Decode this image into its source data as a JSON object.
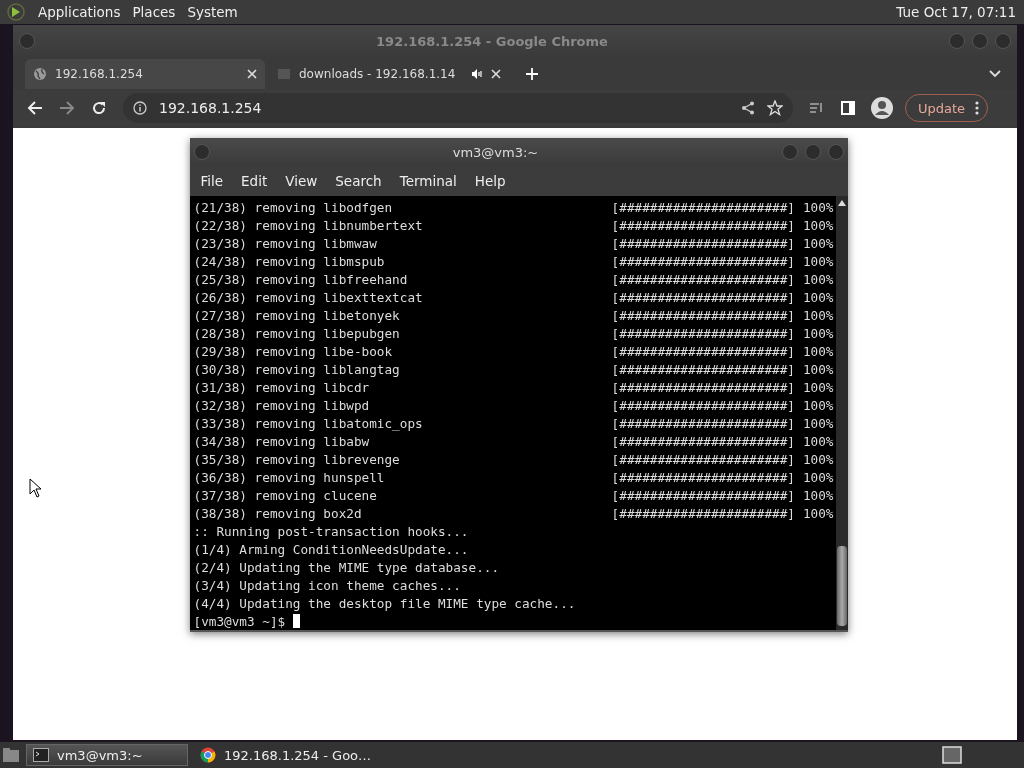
{
  "top_panel": {
    "menus": [
      "Applications",
      "Places",
      "System"
    ],
    "clock": "Tue Oct 17, 07:11"
  },
  "browser": {
    "title": "192.168.1.254 - Google Chrome",
    "tabs": [
      {
        "label": "192.168.1.254",
        "selected": true,
        "kind": "globe",
        "audio": false
      },
      {
        "label": "downloads - 192.168.1.14",
        "selected": false,
        "kind": "folder",
        "audio": true
      }
    ],
    "address": "192.168.1.254",
    "update_button": "Update"
  },
  "terminal": {
    "title": "vm3@vm3:~",
    "menus": [
      "File",
      "Edit",
      "View",
      "Search",
      "Terminal",
      "Help"
    ],
    "progress_rows": [
      {
        "text": "(21/38) removing libodfgen",
        "bar": "[######################]",
        "percent": "100%"
      },
      {
        "text": "(22/38) removing libnumbertext",
        "bar": "[######################]",
        "percent": "100%"
      },
      {
        "text": "(23/38) removing libmwaw",
        "bar": "[######################]",
        "percent": "100%"
      },
      {
        "text": "(24/38) removing libmspub",
        "bar": "[######################]",
        "percent": "100%"
      },
      {
        "text": "(25/38) removing libfreehand",
        "bar": "[######################]",
        "percent": "100%"
      },
      {
        "text": "(26/38) removing libexttextcat",
        "bar": "[######################]",
        "percent": "100%"
      },
      {
        "text": "(27/38) removing libetonyek",
        "bar": "[######################]",
        "percent": "100%"
      },
      {
        "text": "(28/38) removing libepubgen",
        "bar": "[######################]",
        "percent": "100%"
      },
      {
        "text": "(29/38) removing libe-book",
        "bar": "[######################]",
        "percent": "100%"
      },
      {
        "text": "(30/38) removing liblangtag",
        "bar": "[######################]",
        "percent": "100%"
      },
      {
        "text": "(31/38) removing libcdr",
        "bar": "[######################]",
        "percent": "100%"
      },
      {
        "text": "(32/38) removing libwpd",
        "bar": "[######################]",
        "percent": "100%"
      },
      {
        "text": "(33/38) removing libatomic_ops",
        "bar": "[######################]",
        "percent": "100%"
      },
      {
        "text": "(34/38) removing libabw",
        "bar": "[######################]",
        "percent": "100%"
      },
      {
        "text": "(35/38) removing librevenge",
        "bar": "[######################]",
        "percent": "100%"
      },
      {
        "text": "(36/38) removing hunspell",
        "bar": "[######################]",
        "percent": "100%"
      },
      {
        "text": "(37/38) removing clucene",
        "bar": "[######################]",
        "percent": "100%"
      },
      {
        "text": "(38/38) removing box2d",
        "bar": "[######################]",
        "percent": "100%"
      }
    ],
    "lines": [
      ":: Running post-transaction hooks...",
      "(1/4) Arming ConditionNeedsUpdate...",
      "(2/4) Updating the MIME type database...",
      "(3/4) Updating icon theme caches...",
      "(4/4) Updating the desktop file MIME type cache..."
    ],
    "prompt": "[vm3@vm3 ~]$"
  },
  "taskbar": {
    "items": [
      {
        "label": "vm3@vm3:~",
        "selected": true,
        "kind": "terminal"
      },
      {
        "label": "192.168.1.254 - Goo…",
        "selected": false,
        "kind": "chrome"
      }
    ]
  }
}
